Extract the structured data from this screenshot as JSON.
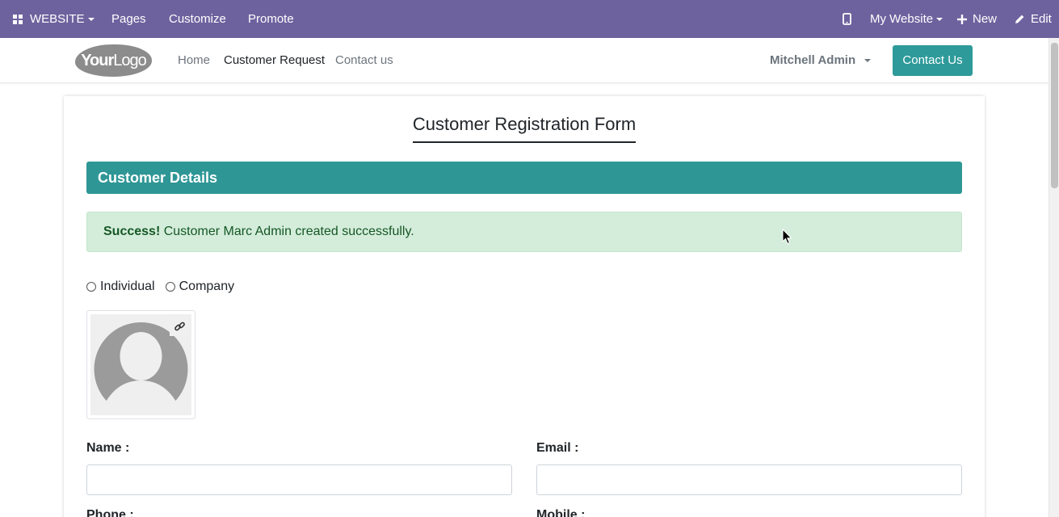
{
  "adminbar": {
    "website_label": "WEBSITE",
    "pages_label": "Pages",
    "customize_label": "Customize",
    "promote_label": "Promote",
    "my_website_label": "My Website",
    "new_label": "New",
    "edit_label": "Edit",
    "bg_color": "#6e629e"
  },
  "header": {
    "logo_bold": "Your",
    "logo_light": "Logo",
    "nav": [
      "Home",
      "Customer Request",
      "Contact us"
    ],
    "active_nav": "Customer Request",
    "user_name": "Mitchell Admin",
    "contact_button": "Contact Us",
    "accent_color": "#2e9a9a"
  },
  "form": {
    "title": "Customer Registration Form",
    "section_title": "Customer Details",
    "alert_strong": "Success!",
    "alert_text": " Customer Marc Admin created successfully.",
    "radio_options": [
      "Individual",
      "Company"
    ],
    "name_label": "Name :",
    "name_value": "",
    "email_label": "Email :",
    "email_value": "",
    "phone_label": "Phone :",
    "mobile_label": "Mobile :"
  },
  "icons": {
    "grid": "grid-icon",
    "mobile": "mobile-icon",
    "plus": "plus-icon",
    "pencil": "pencil-icon",
    "link": "link-icon",
    "avatar": "avatar-placeholder-icon"
  }
}
